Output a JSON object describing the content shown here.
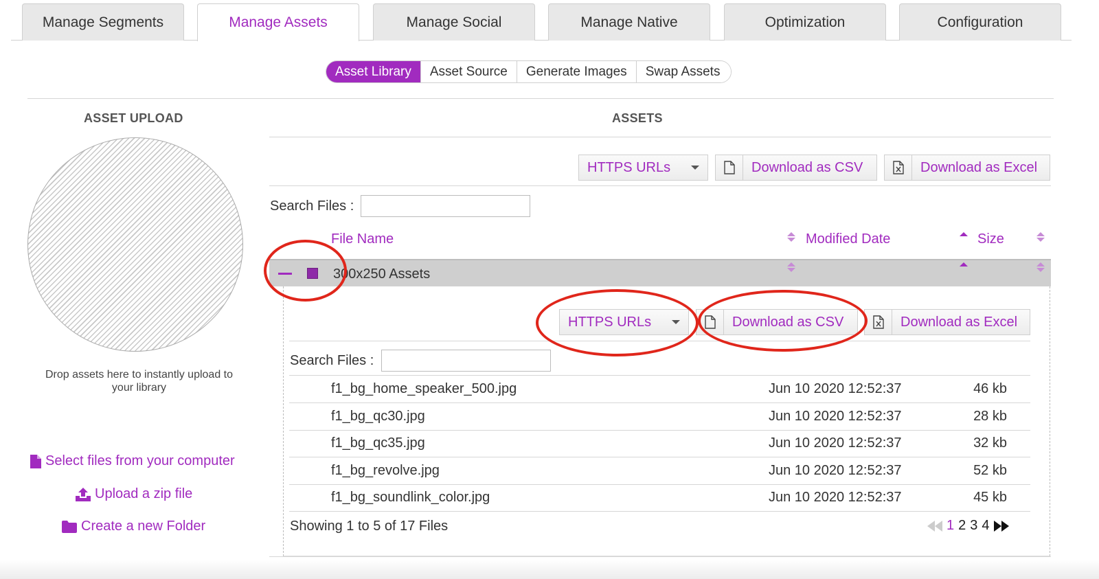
{
  "tabs": [
    {
      "label": "Manage Segments"
    },
    {
      "label": "Manage Assets",
      "active": true
    },
    {
      "label": "Manage Social"
    },
    {
      "label": "Manage Native"
    },
    {
      "label": "Optimization"
    },
    {
      "label": "Configuration"
    }
  ],
  "subtabs": [
    {
      "label": "Asset Library",
      "active": true
    },
    {
      "label": "Asset Source"
    },
    {
      "label": "Generate Images"
    },
    {
      "label": "Swap Assets"
    }
  ],
  "upload": {
    "title": "ASSET UPLOAD",
    "drop_text": "Drop assets here to instantly upload to your library",
    "select_files": "Select files from your computer",
    "upload_zip": "Upload a zip file",
    "new_folder": "Create a new Folder"
  },
  "assets": {
    "title": "ASSETS",
    "url_type": "HTTPS URLs",
    "download_csv": "Download as CSV",
    "download_excel": "Download as Excel",
    "search_label": "Search Files :",
    "search_value": "",
    "columns": {
      "name": "File Name",
      "modified": "Modified Date",
      "size": "Size"
    }
  },
  "folder": {
    "name": "300x250 Assets",
    "url_type": "HTTPS URLs",
    "download_csv": "Download as CSV",
    "download_excel": "Download as Excel",
    "search_label": "Search Files :",
    "search_value": "",
    "files": [
      {
        "name": "f1_bg_home_speaker_500.jpg",
        "date": "Jun 10 2020 12:52:37",
        "size": "46 kb"
      },
      {
        "name": "f1_bg_qc30.jpg",
        "date": "Jun 10 2020 12:52:37",
        "size": "28 kb"
      },
      {
        "name": "f1_bg_qc35.jpg",
        "date": "Jun 10 2020 12:52:37",
        "size": "32 kb"
      },
      {
        "name": "f1_bg_revolve.jpg",
        "date": "Jun 10 2020 12:52:37",
        "size": "52 kb"
      },
      {
        "name": "f1_bg_soundlink_color.jpg",
        "date": "Jun 10 2020 12:52:37",
        "size": "45 kb"
      }
    ],
    "showing": "Showing 1 to 5 of 17 Files",
    "pages": [
      "1",
      "2",
      "3",
      "4"
    ],
    "current_page": "1"
  },
  "colors": {
    "accent": "#a12bbf",
    "annotation": "#e0261b"
  }
}
